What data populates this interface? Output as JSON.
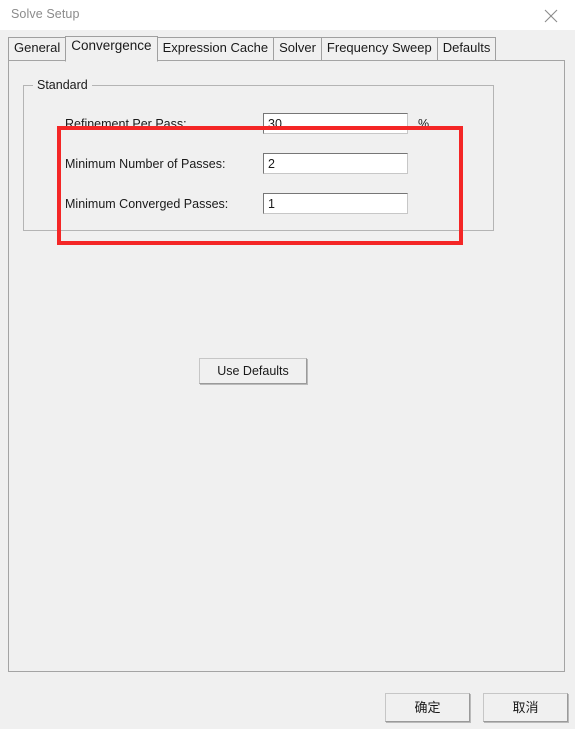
{
  "window": {
    "title": "Solve Setup",
    "close_icon": "close-icon"
  },
  "tabs": [
    {
      "label": "General",
      "active": false
    },
    {
      "label": "Convergence",
      "active": true
    },
    {
      "label": "Expression Cache",
      "active": false
    },
    {
      "label": "Solver",
      "active": false
    },
    {
      "label": "Frequency Sweep",
      "active": false
    },
    {
      "label": "Defaults",
      "active": false
    }
  ],
  "convergence": {
    "group_title": "Standard",
    "rows": [
      {
        "label": "Refinement Per Pass:",
        "value": "30",
        "unit": "%"
      },
      {
        "label": "Minimum Number of Passes:",
        "value": "2",
        "unit": ""
      },
      {
        "label": "Minimum Converged Passes:",
        "value": "1",
        "unit": ""
      }
    ],
    "use_defaults_label": "Use Defaults"
  },
  "footer": {
    "ok_label": "确定",
    "cancel_label": "取消"
  },
  "annotation": {
    "color": "#f42626"
  }
}
